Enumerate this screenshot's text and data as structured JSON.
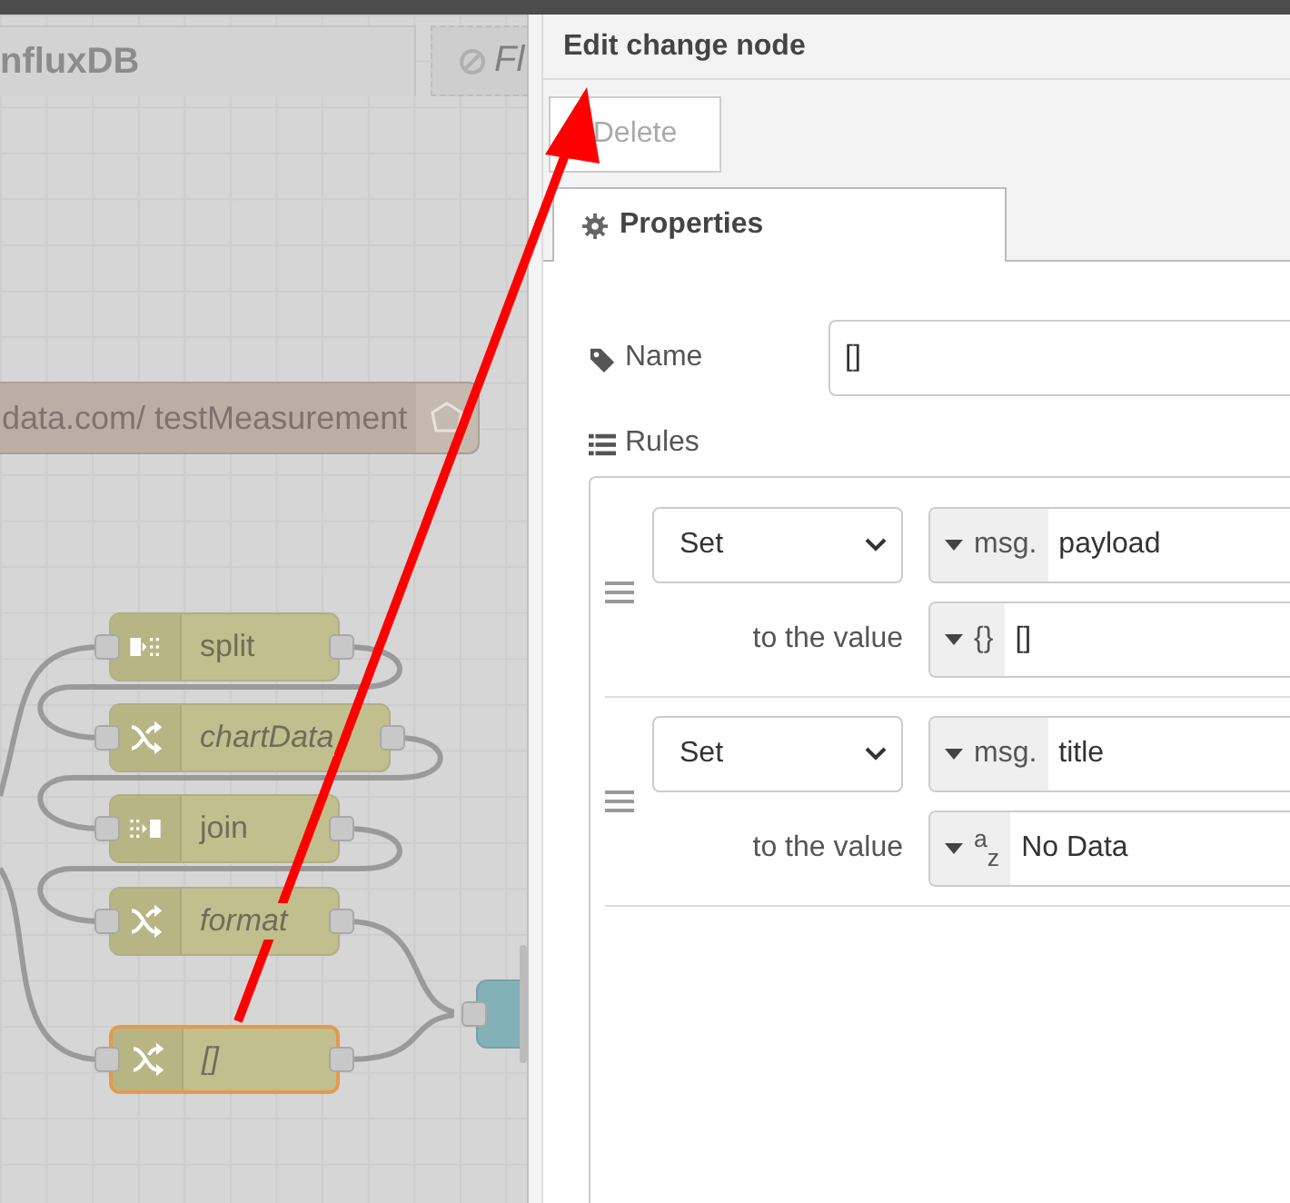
{
  "canvas": {
    "tabs": [
      {
        "label": "nfluxDB",
        "selected": true,
        "disabled": false
      },
      {
        "label": "Fl",
        "selected": false,
        "disabled": true
      }
    ],
    "info_node": {
      "label": "data.com/ testMeasurement"
    },
    "nodes": [
      {
        "kind": "split",
        "label": "split",
        "italic": false,
        "selected": false
      },
      {
        "kind": "change",
        "label": "chartData",
        "italic": true,
        "selected": false
      },
      {
        "kind": "join",
        "label": "join",
        "italic": false,
        "selected": false
      },
      {
        "kind": "change",
        "label": "format",
        "italic": true,
        "selected": false
      },
      {
        "kind": "change",
        "label": "[]",
        "italic": true,
        "selected": true
      },
      {
        "kind": "output",
        "selected": false
      }
    ]
  },
  "annotation_arrow": true,
  "editor": {
    "title": "Edit change node",
    "delete_button": "Delete",
    "tabs": [
      {
        "label": "Properties",
        "selected": true
      }
    ],
    "name": {
      "label": "Name",
      "value": "[]"
    },
    "rules_label": "Rules",
    "rules": [
      {
        "action": "Set",
        "target_prefix": "msg.",
        "target": "payload",
        "to_label": "to the value",
        "value_type": "{}",
        "value": "[]"
      },
      {
        "action": "Set",
        "target_prefix": "msg.",
        "target": "title",
        "to_label": "to the value",
        "value_type": "$^{a}$$_{z}$",
        "value": "No Data"
      }
    ]
  }
}
